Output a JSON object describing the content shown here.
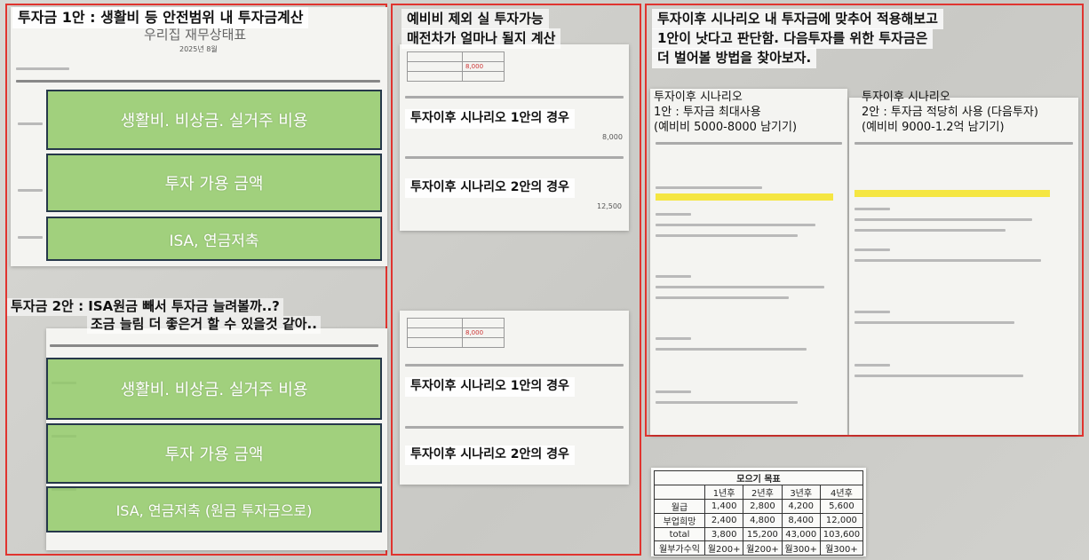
{
  "panel1": {
    "caption_top": "투자금 1안 : 생활비 등 안전범위 내 투자금계산",
    "sheet_title": "우리집 재무상태표",
    "sheet_date": "2025년 8월",
    "band1": "생활비. 비상금. 실거주 비용",
    "band2": "투자 가용 금액",
    "band3": "ISA, 연금저축",
    "caption_bottom_line1": "투자금 2안 : ISA원금 빼서 투자금 늘려볼까..?",
    "caption_bottom_line2": "조금 늘림 더 좋은거 할 수 있을것 같아..",
    "band4": "생활비. 비상금. 실거주 비용",
    "band5": "투자 가용 금액",
    "band6": "ISA, 연금저축 (원금 투자금으로)"
  },
  "panel2": {
    "caption_line1": "예비비 제외 실 투자가능",
    "caption_line2": "매전차가 얼마나 될지 계산",
    "top_value": "8,000",
    "top_value2": "8,000",
    "top_value3": "12,500",
    "bottom_value": "8,000",
    "scenario1_top": "투자이후 시나리오 1안의 경우",
    "scenario2_top": "투자이후 시나리오 2안의 경우",
    "scenario1_bottom": "투자이후 시나리오 1안의 경우",
    "scenario2_bottom": "투자이후 시나리오 2안의 경우"
  },
  "panel3": {
    "caption_line1": "투자이후 시나리오 내 투자금에 맞추어 적용해보고",
    "caption_line2": "1안이 낫다고 판단함. 다음투자를 위한 투자금은",
    "caption_line3": "더 벌어볼 방법을 찾아보자.",
    "plan1_line1": "투자이후 시나리오",
    "plan1_line2": "1안 : 투자금 최대사용",
    "plan1_line3": "(예비비 5000-8000 남기기)",
    "plan2_line1": "투자이후 시나리오",
    "plan2_line2": "2안 : 투자금 적당히 사용 (다음투자)",
    "plan2_line3": "(예비비 9000-1.2억 남기기)"
  },
  "savings_goal": {
    "title": "모으기 목표",
    "headers": [
      "",
      "1년후",
      "2년후",
      "3년후",
      "4년후"
    ],
    "rows": [
      [
        "월급",
        "1,400",
        "2,800",
        "4,200",
        "5,600"
      ],
      [
        "부업희망",
        "2,400",
        "4,800",
        "8,400",
        "12,000"
      ],
      [
        "total",
        "3,800",
        "15,200",
        "43,000",
        "103,600"
      ],
      [
        "월부가수익",
        "월200+",
        "월200+",
        "월300+",
        "월300+"
      ]
    ]
  }
}
